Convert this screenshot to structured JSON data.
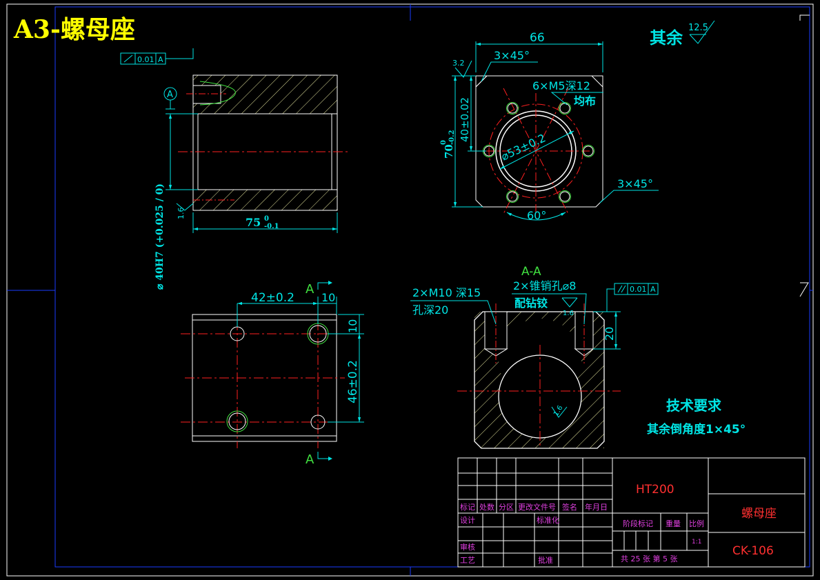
{
  "sheet_title": "A3-螺母座",
  "roughness_note": {
    "label": "其余",
    "value": "12.5"
  },
  "view_front": {
    "flatness_box": {
      "value": "0.01",
      "datum": "A"
    },
    "datum_label": "A",
    "length_dim": "75",
    "length_tol_upper": "0",
    "length_tol_lower": "-0.1",
    "bore_dim": "⌀ 40H7 (+0.025 / 0)",
    "roughness": "1.6"
  },
  "view_side": {
    "width_dim": "66",
    "chamfer_top": "3×45°",
    "chamfer_bottom": "3×45°",
    "roughness": "3.2",
    "height_dim": "70",
    "height_tol_upper": "0",
    "height_tol_lower": "-0.2",
    "center_dim": "40±0.02",
    "thread_holes": "6×M5深12",
    "thread_holes_note": "均布",
    "circle_dim": "⌀53±0.2",
    "angle_dim": "60°"
  },
  "view_top": {
    "dim_42": "42±0.2",
    "dim_10_h": "10",
    "dim_10_v": "10",
    "dim_46": "46±0.2",
    "section_mark_top": "A",
    "section_mark_bottom": "A"
  },
  "view_section": {
    "title": "A-A",
    "tapped_holes_line1": "2×M10 深15",
    "tapped_holes_line2": "孔深20",
    "pin_holes_line1": "2×锥销孔⌀8",
    "pin_holes_line2": "配钻铰",
    "parallel_box": {
      "value": "0.01",
      "datum": "A"
    },
    "dim_20": "20",
    "roughness_top": "1.6",
    "roughness_bore": "1.6"
  },
  "tech_req": {
    "heading": "技术要求",
    "line1": "其余倒角度1×45°"
  },
  "title_block": {
    "material": "HT200",
    "part_name": "螺母座",
    "drawing_no": "CK-106",
    "header_labels": [
      "标记",
      "处数",
      "分区",
      "更改文件号",
      "签名",
      "年月日"
    ],
    "design": "设计",
    "standardize": "标准化",
    "review": "审核",
    "process": "工艺",
    "approve": "批准",
    "stage_mark": "阶段标记",
    "weight": "重量",
    "scale": "比例",
    "scale_value": "1:1",
    "sheets": "共 25 张 第 5 张"
  },
  "colors": {
    "outline": "#ffffff",
    "dimension": "#00e5e5",
    "center_line": "#ff2020",
    "thread": "#40e040",
    "frame": "#1a3cff",
    "title": "#ffff00",
    "title_block_text": "#e040e0",
    "material_text": "#ff3030"
  }
}
